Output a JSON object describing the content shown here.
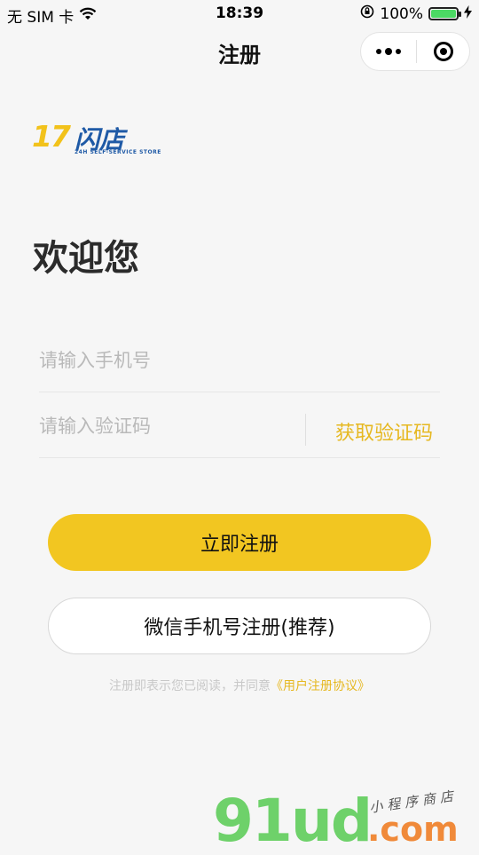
{
  "status_bar": {
    "carrier": "无 SIM 卡",
    "time": "18:39",
    "battery_percent": "100%",
    "icons": [
      "wifi-icon",
      "orientation-lock-icon",
      "battery-icon",
      "charging-icon"
    ]
  },
  "nav": {
    "title": "注册",
    "more_icon": "more-dots-icon",
    "close_icon": "target-circle-icon"
  },
  "logo": {
    "number": "17",
    "name": "闪店",
    "tagline": "24H SELF-SERVICE STORE"
  },
  "welcome": "欢迎您",
  "form": {
    "phone_placeholder": "请输入手机号",
    "code_placeholder": "请输入验证码",
    "get_code_label": "获取验证码"
  },
  "buttons": {
    "register": "立即注册",
    "wechat_register": "微信手机号注册(推荐)"
  },
  "agreement": {
    "text": "注册即表示您已阅读，并同意",
    "link": "《用户注册协议》"
  },
  "watermark": {
    "brand": "91ud",
    "domain": ".com",
    "subtitle": "小程序商店"
  },
  "colors": {
    "accent": "#f2c621",
    "link": "#e6b820",
    "background": "#f6f6f6",
    "logo_blue": "#1f5aa6"
  }
}
